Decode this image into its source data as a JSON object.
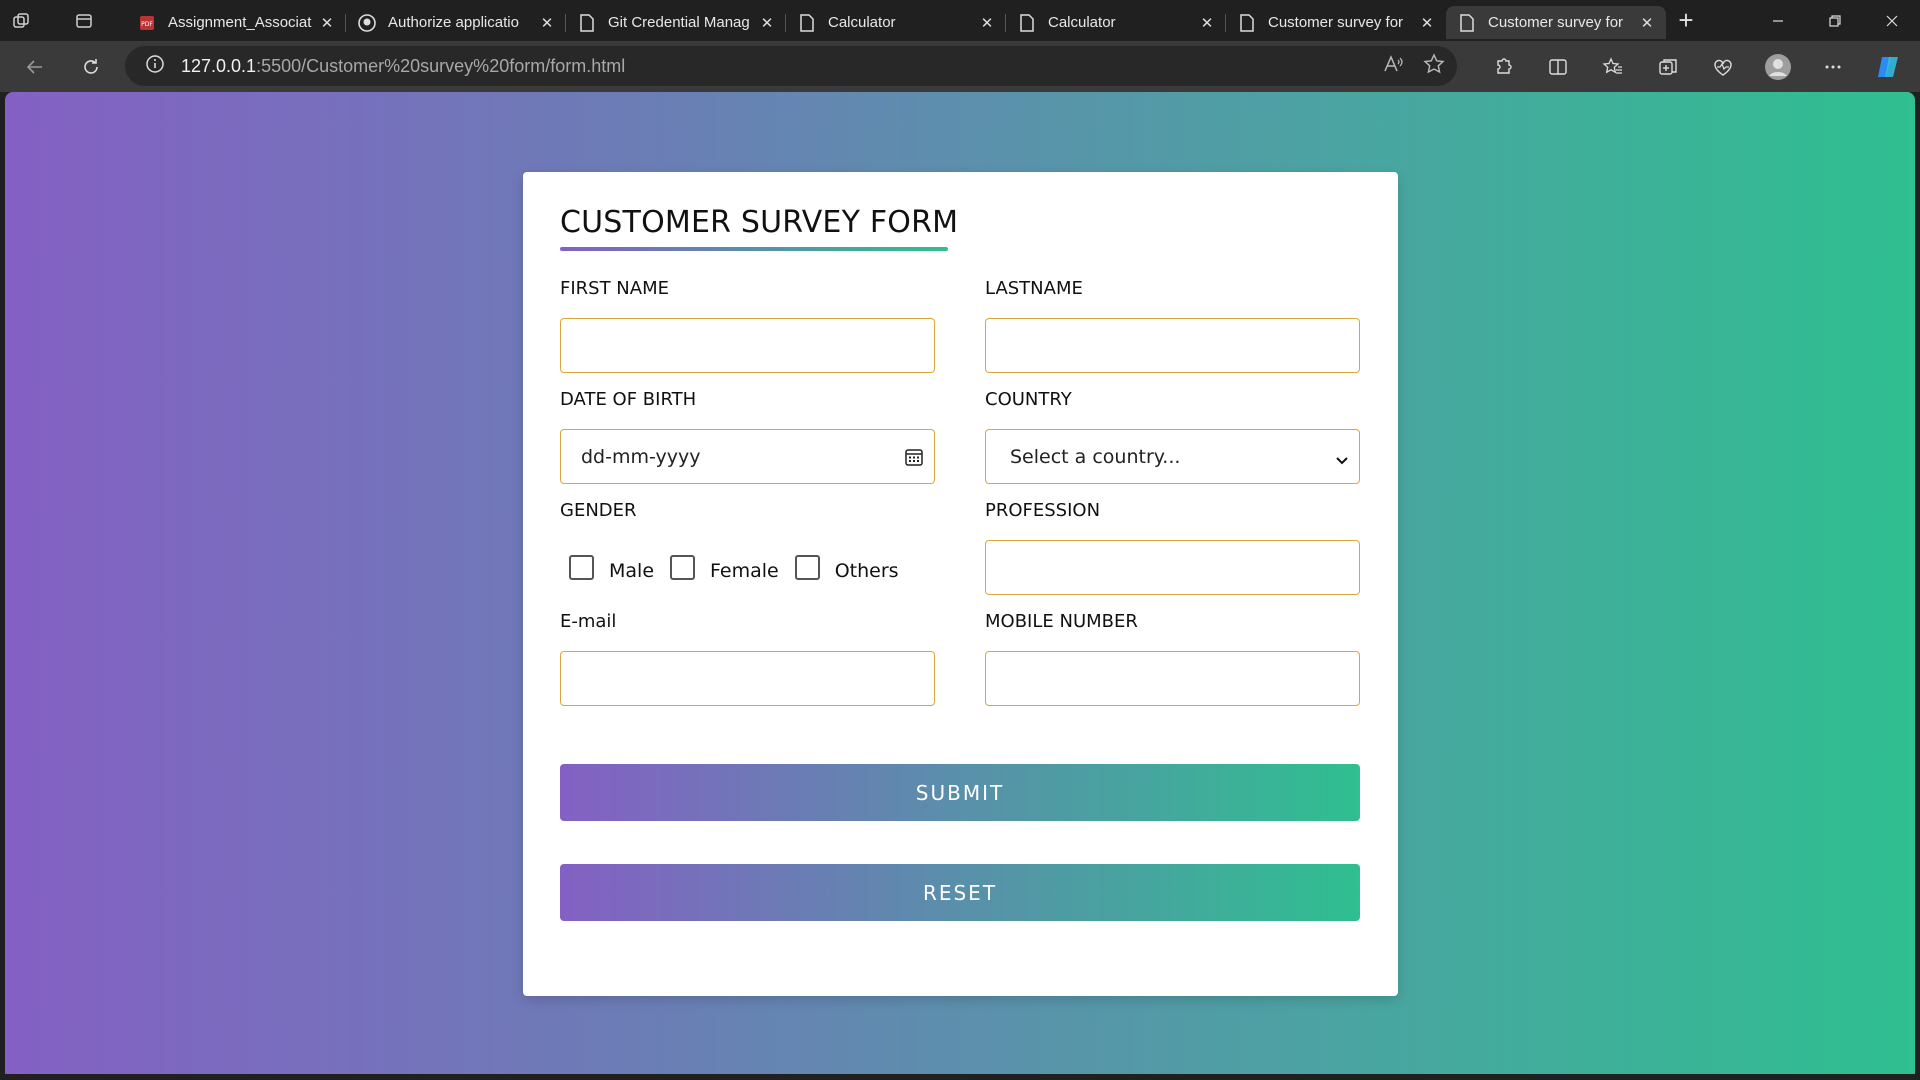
{
  "browser": {
    "tabs": [
      {
        "title": "Assignment_Associat",
        "icon": "pdf-icon",
        "active": false
      },
      {
        "title": "Authorize applicatio",
        "icon": "github-icon",
        "active": false
      },
      {
        "title": "Git Credential Manag",
        "icon": "page-icon",
        "active": false
      },
      {
        "title": "Calculator",
        "icon": "page-icon",
        "active": false
      },
      {
        "title": "Calculator",
        "icon": "page-icon",
        "active": false
      },
      {
        "title": "Customer survey for",
        "icon": "page-icon",
        "active": false
      },
      {
        "title": "Customer survey for",
        "icon": "page-icon",
        "active": true
      }
    ],
    "close_glyph": "✕",
    "new_tab_glyph": "+",
    "url_host": "127.0.0.1",
    "url_rest": ":5500/Customer%20survey%20form/form.html"
  },
  "form": {
    "title": "CUSTOMER SURVEY FORM",
    "first_name_label": "FIRST NAME",
    "last_name_label": "LASTNAME",
    "dob_label": "DATE OF BIRTH",
    "dob_placeholder": "dd-mm-yyyy",
    "country_label": "COUNTRY",
    "country_selected": "Select a country...",
    "gender_label": "GENDER",
    "gender_options": [
      "Male",
      "Female",
      "Others"
    ],
    "profession_label": "PROFESSION",
    "email_label": "E-mail",
    "mobile_label": "MOBILE NUMBER",
    "submit_label": "SUBMIT",
    "reset_label": "RESET"
  },
  "colors": {
    "gradient_start": "#8460c4",
    "gradient_end": "#2fbf90",
    "input_border": "#d8a93a"
  }
}
